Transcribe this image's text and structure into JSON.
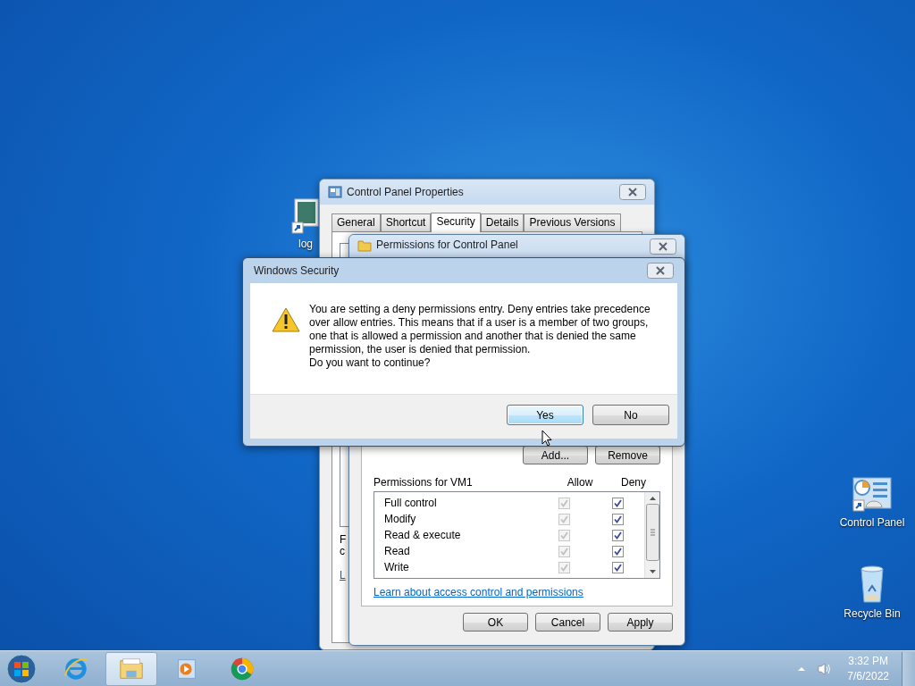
{
  "desktop_icons": [
    {
      "kind": "image",
      "label": "log"
    },
    {
      "kind": "panel",
      "label": "Control Panel"
    },
    {
      "kind": "bin",
      "label": "Recycle Bin"
    }
  ],
  "properties_window": {
    "title": "Control Panel Properties",
    "tabs": [
      {
        "label": "General",
        "selected": false
      },
      {
        "label": "Shortcut",
        "selected": false
      },
      {
        "label": "Security",
        "selected": true
      },
      {
        "label": "Details",
        "selected": false
      },
      {
        "label": "Previous Versions",
        "selected": false
      }
    ],
    "partial_texts": [
      {
        "kind": "line",
        "text": "F"
      },
      {
        "kind": "line",
        "text": "c"
      },
      {
        "kind": "link",
        "text": "L"
      }
    ]
  },
  "permissions_window": {
    "title": "Permissions for Control Panel",
    "group_buttons": [
      "Add...",
      "Remove"
    ],
    "list_label": "Permissions for VM1",
    "columns": [
      "Allow",
      "Deny"
    ],
    "rows": [
      {
        "name": "Full control",
        "allow": true,
        "allow_disabled": true,
        "deny": true
      },
      {
        "name": "Modify",
        "allow": true,
        "allow_disabled": true,
        "deny": true
      },
      {
        "name": "Read & execute",
        "allow": true,
        "allow_disabled": true,
        "deny": true
      },
      {
        "name": "Read",
        "allow": true,
        "allow_disabled": true,
        "deny": true
      },
      {
        "name": "Write",
        "allow": true,
        "allow_disabled": true,
        "deny": true
      }
    ],
    "link": "Learn about access control and permissions",
    "buttons": [
      "OK",
      "Cancel",
      "Apply"
    ]
  },
  "dialog": {
    "title": "Windows Security",
    "message": "You are setting a deny permissions entry. Deny entries take precedence over allow entries. This means that if a user is a member of two groups, one that is allowed a permission and another that is denied the same permission, the user is denied that permission.",
    "question": "Do you want to continue?",
    "buttons": [
      {
        "label": "Yes",
        "selected": true
      },
      {
        "label": "No",
        "selected": false
      }
    ]
  },
  "taskbar": {
    "apps": [
      {
        "kind": "browser-e",
        "selected": false
      },
      {
        "kind": "folder",
        "selected": true
      },
      {
        "kind": "player",
        "selected": false
      },
      {
        "kind": "browser-c",
        "selected": false
      }
    ],
    "time": "3:32 PM",
    "date": "7/6/2022"
  }
}
